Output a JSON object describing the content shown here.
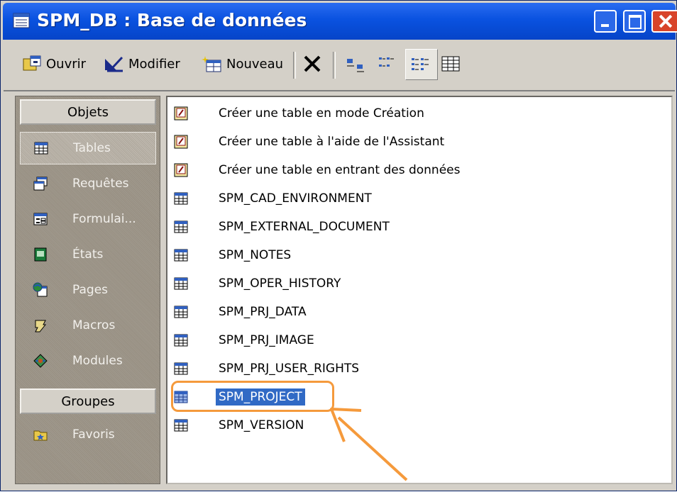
{
  "window": {
    "title": "SPM_DB : Base de données"
  },
  "toolbar": {
    "open_label": "Ouvrir",
    "modify_label": "Modifier",
    "new_label": "Nouveau"
  },
  "sidebar": {
    "objects_header": "Objets",
    "groups_header": "Groupes",
    "items": [
      {
        "label": "Tables",
        "icon": "table-icon"
      },
      {
        "label": "Requêtes",
        "icon": "query-icon"
      },
      {
        "label": "Formulai...",
        "icon": "form-icon"
      },
      {
        "label": "États",
        "icon": "report-icon"
      },
      {
        "label": "Pages",
        "icon": "page-icon"
      },
      {
        "label": "Macros",
        "icon": "macro-icon"
      },
      {
        "label": "Modules",
        "icon": "module-icon"
      }
    ],
    "groups": [
      {
        "label": "Favoris",
        "icon": "favorites-folder-icon"
      }
    ]
  },
  "list": {
    "items": [
      {
        "label": "Créer une table en mode Création",
        "icon": "wizard-icon"
      },
      {
        "label": "Créer une table à l'aide de l'Assistant",
        "icon": "wizard-icon"
      },
      {
        "label": "Créer une table en entrant des données",
        "icon": "wizard-icon"
      },
      {
        "label": "SPM_CAD_ENVIRONMENT",
        "icon": "table-icon"
      },
      {
        "label": "SPM_EXTERNAL_DOCUMENT",
        "icon": "table-icon"
      },
      {
        "label": "SPM_NOTES",
        "icon": "table-icon"
      },
      {
        "label": "SPM_OPER_HISTORY",
        "icon": "table-icon"
      },
      {
        "label": "SPM_PRJ_DATA",
        "icon": "table-icon"
      },
      {
        "label": "SPM_PRJ_IMAGE",
        "icon": "table-icon"
      },
      {
        "label": "SPM_PRJ_USER_RIGHTS",
        "icon": "table-icon"
      },
      {
        "label": "SPM_PROJECT",
        "icon": "table-icon",
        "selected": true
      },
      {
        "label": "SPM_VERSION",
        "icon": "table-icon"
      }
    ]
  },
  "colors": {
    "selection": "#316ac5",
    "annotation": "#f59a3c",
    "titlebar": "#0a52e0"
  }
}
